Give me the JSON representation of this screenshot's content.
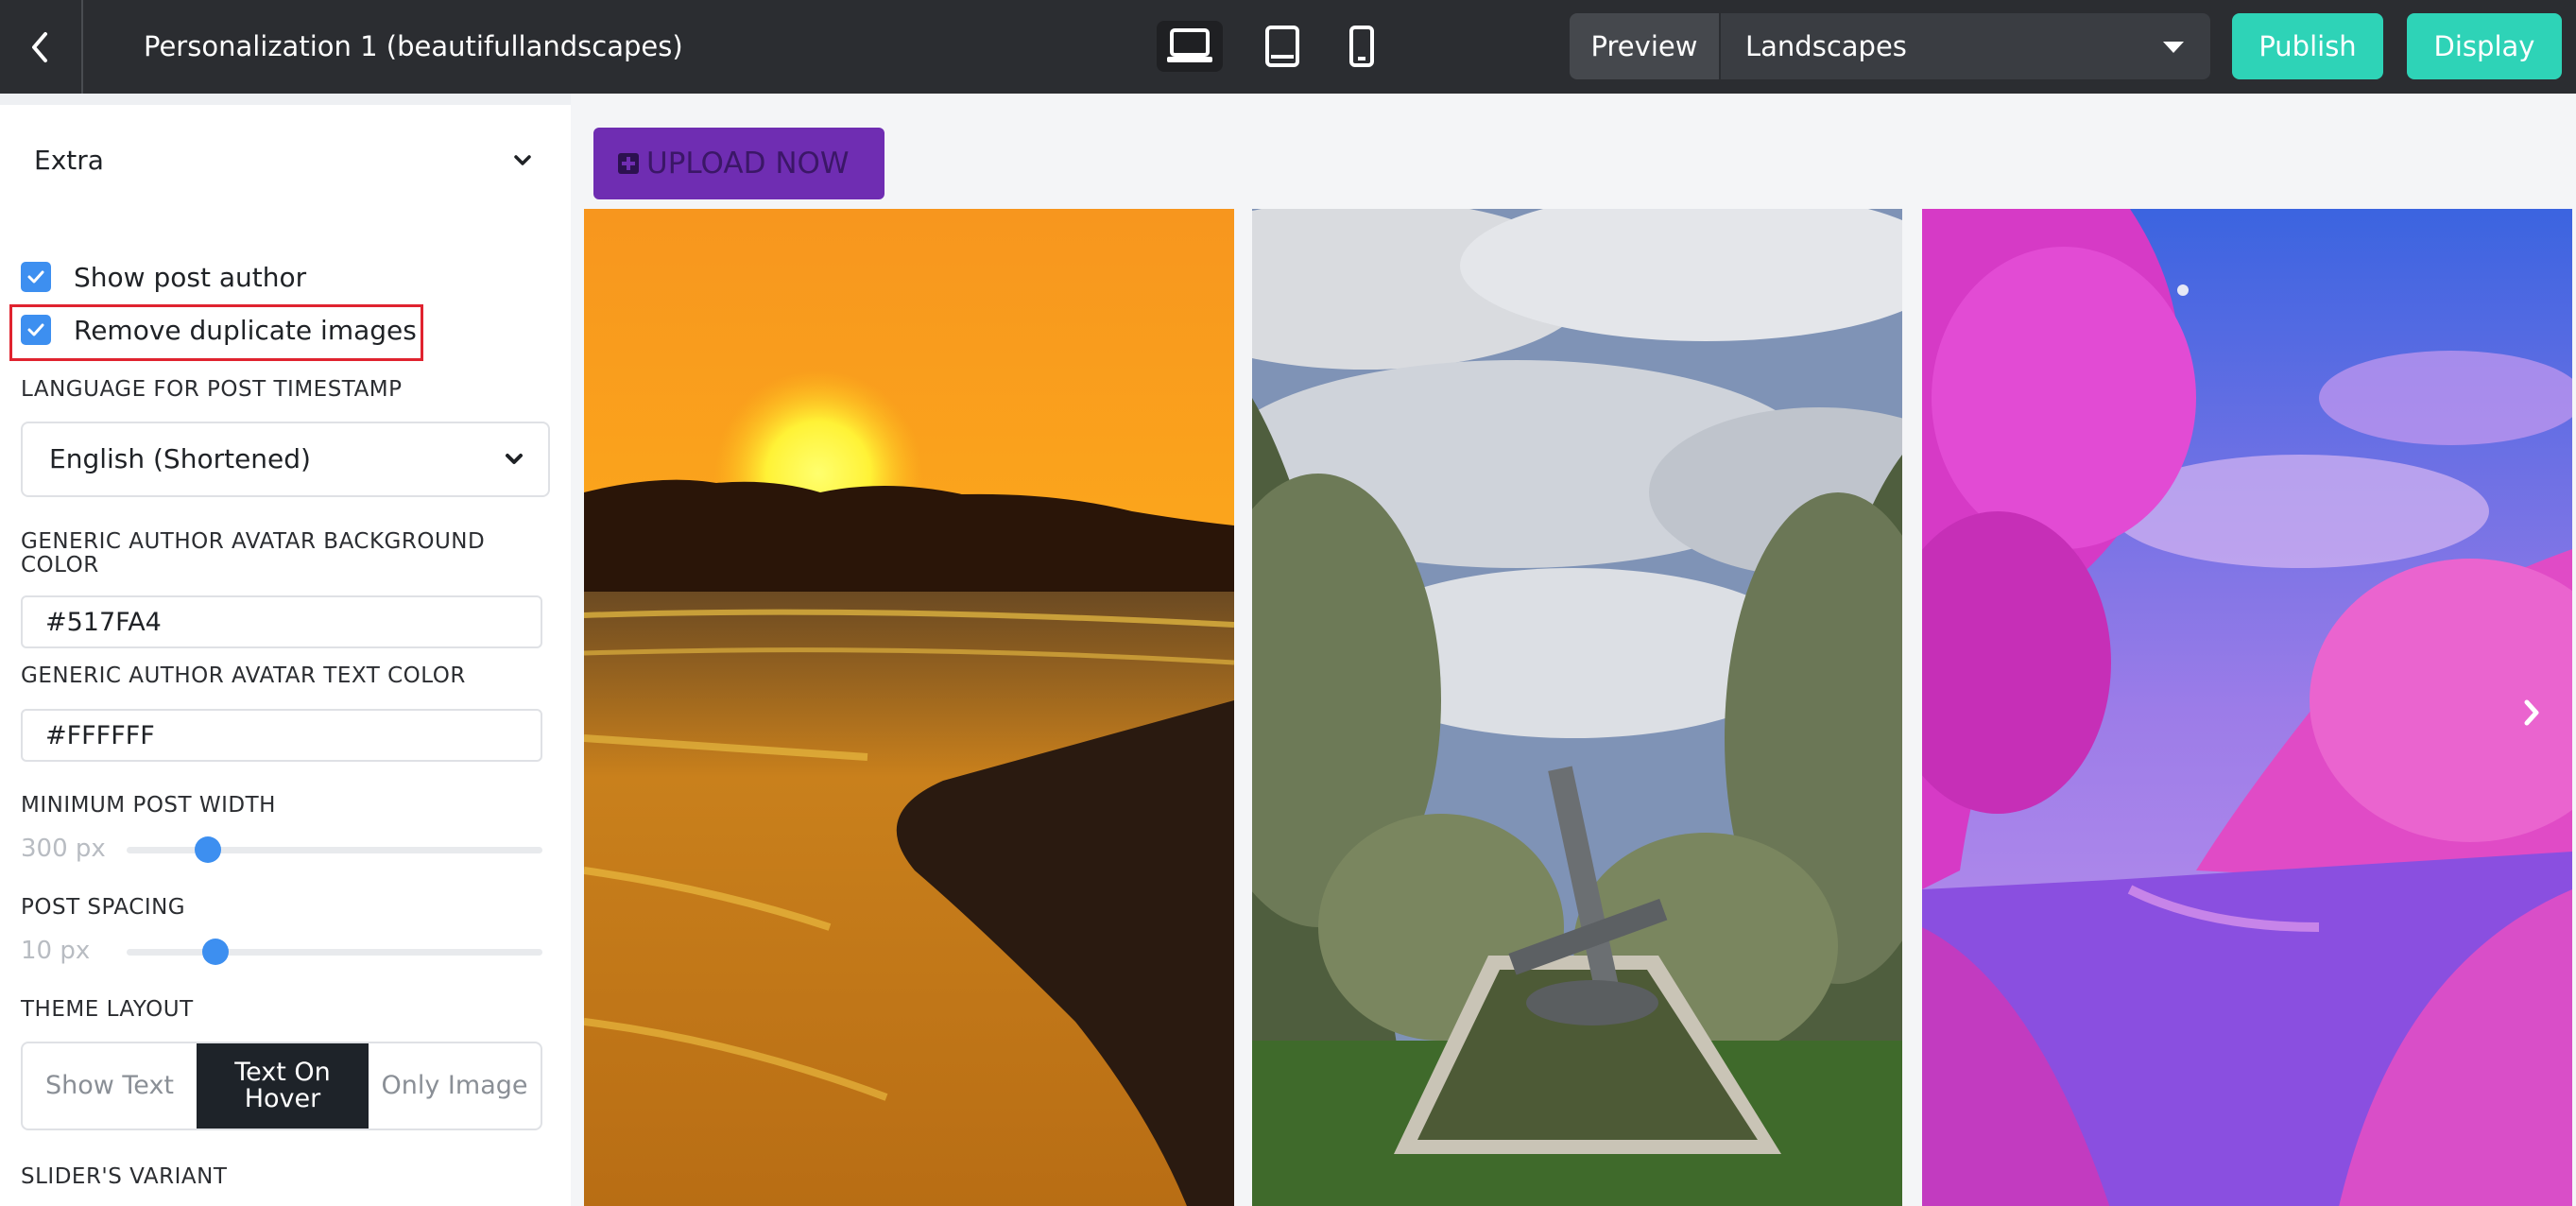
{
  "header": {
    "title": "Personalization 1 (beautifullandscapes)",
    "preview_label": "Preview",
    "feed_selected": "Landscapes",
    "publish_label": "Publish",
    "display_label": "Display",
    "devices": [
      "desktop-icon",
      "tablet-icon",
      "mobile-icon"
    ],
    "active_device": "desktop"
  },
  "sidebar": {
    "section_title": "Extra",
    "checkboxes": [
      {
        "label": "Show post author",
        "checked": true
      },
      {
        "label": "Remove duplicate images",
        "checked": true
      }
    ],
    "language_label": "LANGUAGE FOR POST TIMESTAMP",
    "language_value": "English (Shortened)",
    "avatar_bg_label": "GENERIC AUTHOR AVATAR BACKGROUND COLOR",
    "avatar_bg_value": "#517FA4",
    "avatar_text_label": "GENERIC AUTHOR AVATAR TEXT COLOR",
    "avatar_text_value": "#FFFFFF",
    "min_width_label": "MINIMUM POST WIDTH",
    "min_width_value": "300 px",
    "spacing_label": "POST SPACING",
    "spacing_value": "10 px",
    "theme_layout_label": "THEME LAYOUT",
    "theme_layout_options": [
      "Show Text",
      "Text On Hover",
      "Only Image"
    ],
    "theme_layout_selected": "Text On Hover",
    "slider_variant_label": "SLIDER'S VARIANT"
  },
  "main": {
    "upload_label": "UPLOAD NOW",
    "posts": [
      "sunset-lake-photo",
      "olive-garden-sculpture-photo",
      "pink-blossom-river-photo"
    ]
  },
  "colors": {
    "topbar": "#2b2d31",
    "accent_teal": "#2ed3b7",
    "checkbox_blue": "#3d8ff0",
    "upload_purple": "#6f2db2",
    "highlight_red": "#e0232f"
  }
}
